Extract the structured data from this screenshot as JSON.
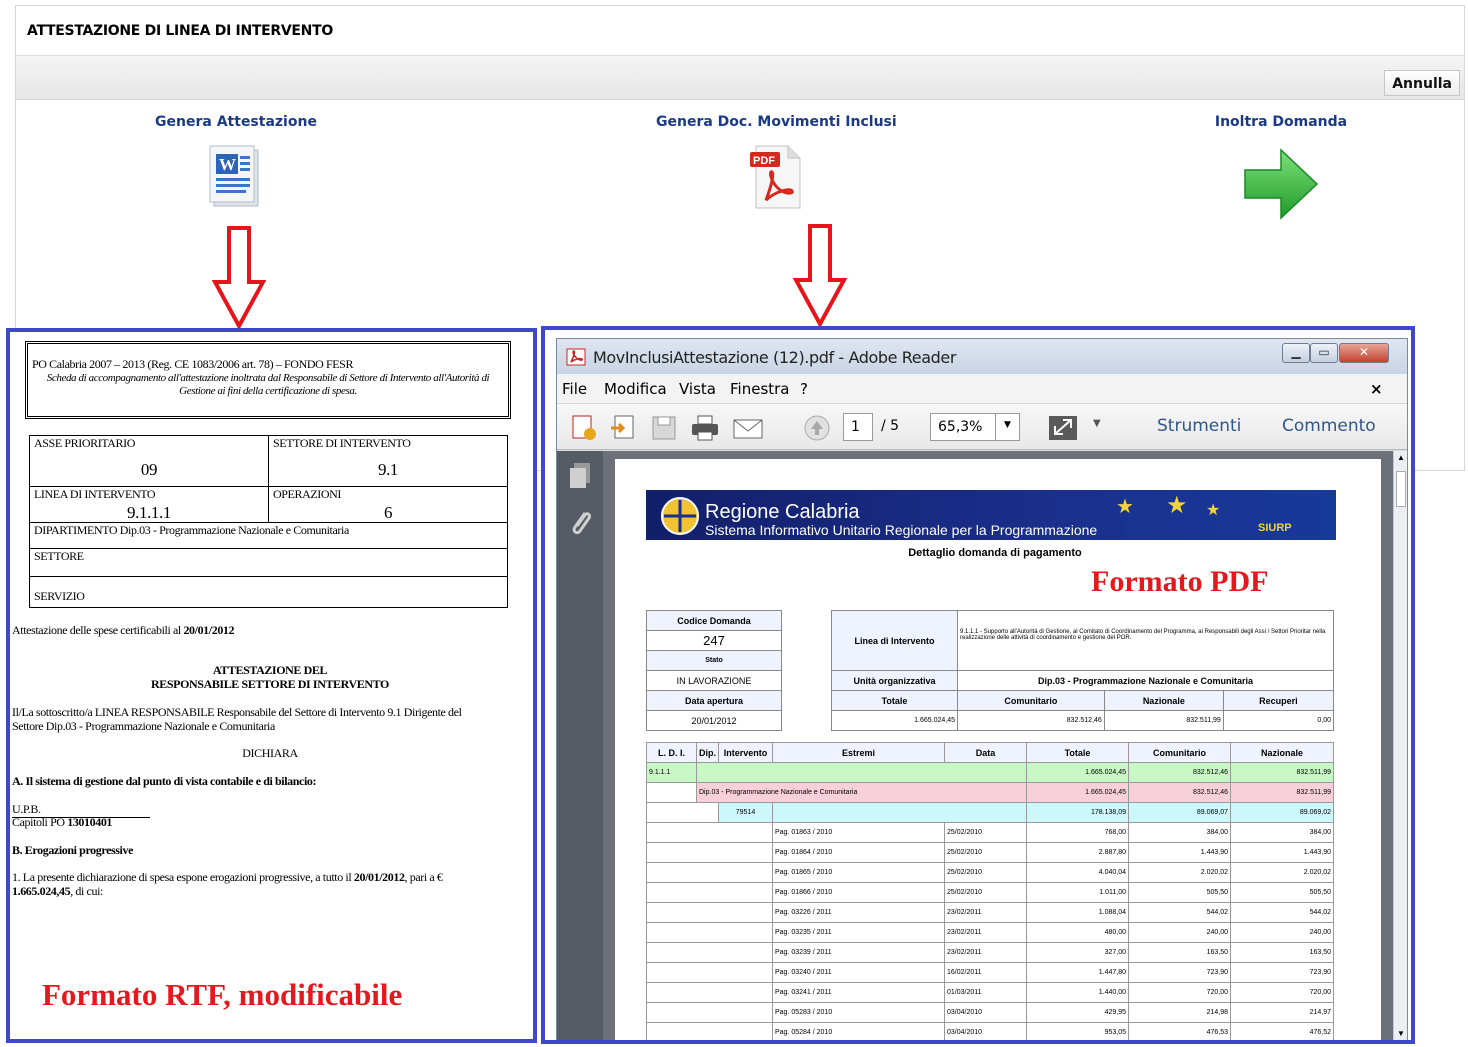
{
  "app": {
    "title": "ATTESTAZIONE DI LINEA DI INTERVENTO",
    "annulla": "Annulla",
    "actions": [
      {
        "label": "Genera Attestazione",
        "icon": "word-document-icon"
      },
      {
        "label": "Genera Doc. Movimenti Inclusi",
        "icon": "pdf-document-icon"
      },
      {
        "label": "Inoltra Domanda",
        "icon": "green-arrow-right-icon"
      }
    ]
  },
  "rtf": {
    "header_line1": "PO Calabria 2007 – 2013 (Reg. CE 1083/2006 art. 78) – FONDO FESR",
    "header_line2": "Scheda di accompagnamento all'attestazione inoltrata dal Responsabile di Settore di Intervento all'Autorità di Gestione ai fini della certificazione di spesa.",
    "asse_label": "ASSE PRIORITARIO",
    "asse_value": "09",
    "settore_label": "SETTORE DI INTERVENTO",
    "settore_value": "9.1",
    "linea_label": "LINEA DI INTERVENTO",
    "linea_value": "9.1.1.1",
    "operazioni_label": "OPERAZIONI",
    "operazioni_value": "6",
    "dipartimento": "DIPARTIMENTO Dip.03 - Programmazione Nazionale e Comunitaria",
    "settore_row": "SETTORE",
    "servizio_row": "SERVIZIO",
    "attestazione_line": "Attestazione delle spese certificabili al ",
    "attestazione_date": "20/01/2012",
    "heading1": "ATTESTAZIONE DEL",
    "heading2": "RESPONSABILE SETTORE DI INTERVENTO",
    "body1": "Il/La sottoscritto/a LINEA RESPONSABILE Responsabile del Settore di Intervento 9.1  Dirigente del",
    "body2": "Settore Dip.03 - Programmazione Nazionale e Comunitaria",
    "dichiara": "DICHIARA",
    "sectA": "A. Il sistema di gestione dal punto di vista contabile e di bilancio:",
    "upb": "U.P.B.",
    "capitoli_label": "Capitoli PO",
    "capitoli_value": "13010401",
    "sectB": "B. Erogazioni progressive",
    "body3": "1. La presente dichiarazione di spesa espone erogazioni progressive, a tutto il ",
    "body3_date": "20/01/2012",
    "body3_tail": ", pari a €",
    "body4": "1.665.024,45",
    "body4_tail": ", di cui:",
    "caption": "Formato RTF, modificabile"
  },
  "pdf": {
    "window_title": "MovInclusiAttestazione (12).pdf - Adobe Reader",
    "menu": [
      "File",
      "Modifica",
      "Vista",
      "Finestra",
      "?"
    ],
    "page_current": "1",
    "page_total": "/ 5",
    "zoom": "65,3%",
    "strumenti": "Strumenti",
    "commento": "Commento",
    "banner_title": "Regione Calabria",
    "banner_subtitle": "Sistema Informativo Unitario Regionale per la Programmazione",
    "banner_logo": "SIURP",
    "doc_subtitle": "Dettaglio domanda di pagamento",
    "caption": "Formato PDF",
    "codice_label": "Codice Domanda",
    "codice_value": "247",
    "stato_label": "Stato",
    "stato_value": "IN LAVORAZIONE",
    "apertura_label": "Data apertura",
    "apertura_value": "20/01/2012",
    "linea_label": "Linea di Intervento",
    "linea_value": "9.1.1.1 - Supporto all'Autorità di Gestione, al Comitato di Coordinamento del Programma, ai Responsabili degli Assi / Settori Prioritar nella realizzazione delle attività di coordinamento e gestione del POR.",
    "unita_label": "Unità organizzativa",
    "unita_value": "Dip.03 - Programmazione Nazionale e Comunitaria",
    "totale_label": "Totale",
    "comunitario_label": "Comunitario",
    "nazionale_label": "Nazionale",
    "recuperi_label": "Recuperi",
    "totale_value": "1.665.024,45",
    "comunitario_value": "832.512,46",
    "nazionale_value": "832.511,99",
    "recuperi_value": "0,00",
    "cols": [
      "L. D. I.",
      "Dip.",
      "Intervento",
      "Estremi",
      "Data",
      "Totale",
      "Comunitario",
      "Nazionale"
    ],
    "row_ldi": [
      "9.1.1.1",
      "1.665.024,45",
      "832.512,46",
      "832.511,99"
    ],
    "row_dip": [
      "Dip.03 - Programmazione Nazionale e Comunitaria",
      "1.665.024,45",
      "832.512,46",
      "832.511,99"
    ],
    "row_int": [
      "79514",
      "178.138,09",
      "89.069,07",
      "89.069,02"
    ],
    "rows": [
      [
        "Pag. 01863 / 2010",
        "25/02/2010",
        "768,00",
        "384,00",
        "384,00"
      ],
      [
        "Pag. 01864 / 2010",
        "25/02/2010",
        "2.887,80",
        "1.443,90",
        "1.443,90"
      ],
      [
        "Pag. 01865 / 2010",
        "25/02/2010",
        "4.040,04",
        "2.020,02",
        "2.020,02"
      ],
      [
        "Pag. 01866 / 2010",
        "25/02/2010",
        "1.011,00",
        "505,50",
        "505,50"
      ],
      [
        "Pag. 03226 / 2011",
        "23/02/2011",
        "1.088,04",
        "544,02",
        "544,02"
      ],
      [
        "Pag. 03235 / 2011",
        "23/02/2011",
        "480,00",
        "240,00",
        "240,00"
      ],
      [
        "Pag. 03239 / 2011",
        "23/02/2011",
        "327,00",
        "163,50",
        "163,50"
      ],
      [
        "Pag. 03240 / 2011",
        "16/02/2011",
        "1.447,80",
        "723,90",
        "723,90"
      ],
      [
        "Pag. 03241 / 2011",
        "01/03/2011",
        "1.440,00",
        "720,00",
        "720,00"
      ],
      [
        "Pag. 05283 / 2010",
        "03/04/2010",
        "429,95",
        "214,98",
        "214,97"
      ],
      [
        "Pag. 05284 / 2010",
        "03/04/2010",
        "953,05",
        "476,53",
        "476,52"
      ]
    ]
  }
}
